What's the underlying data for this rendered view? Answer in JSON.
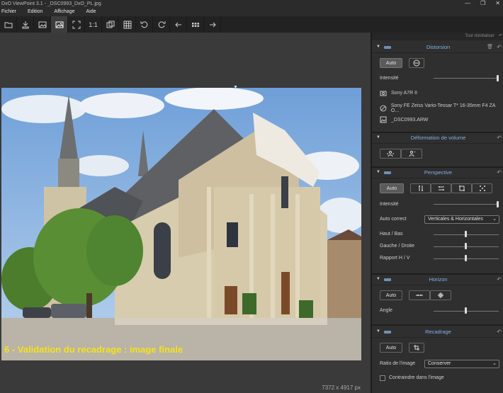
{
  "window": {
    "title": "DxO ViewPoint 3.1 - _DSC0993_DxO_PL.jpg",
    "minimize": "—",
    "maximize": "❐",
    "close": "✕"
  },
  "menu": {
    "items": [
      "Fichier",
      "Edition",
      "Affichage",
      "Aide"
    ]
  },
  "toolbar": {
    "one_to_one": "1:1"
  },
  "viewer": {
    "caption": "6 - Validation du recadrage : image finale",
    "dimensions": "7372 x 4917 px"
  },
  "panel": {
    "reset_all": "Tout réinitialiser",
    "distorsion": {
      "title": "Distorsion",
      "auto": "Auto",
      "intensity_label": "Intensité",
      "intensity": 1.0,
      "camera": "Sony A7R II",
      "lens": "Sony FE Zeiss Vario-Tessar T* 16-35mm F4 ZA O...",
      "file": "_DSC0993.ARW"
    },
    "volume": {
      "title": "Déformation de volume"
    },
    "perspective": {
      "title": "Perspective",
      "auto": "Auto",
      "intensity_label": "Intensité",
      "intensity": 1.0,
      "auto_correct_label": "Auto correct",
      "auto_correct_value": "Verticales & Horizontales",
      "haut_bas_label": "Haut / Bas",
      "haut_bas": 0.5,
      "gauche_droite_label": "Gauche / Droite",
      "gauche_droite": 0.5,
      "rapport_label": "Rapport H / V",
      "rapport": 0.5
    },
    "horizon": {
      "title": "Horizon",
      "auto": "Auto",
      "angle_label": "Angle",
      "angle": 0.5
    },
    "recadrage": {
      "title": "Recadrage",
      "auto": "Auto",
      "ratio_label": "Ratio de l'image",
      "ratio_value": "Conserver",
      "constrain_label": "Contraindre dans l'image"
    }
  },
  "colors": {
    "accent_title": "#7fb0e8",
    "caption": "#f5e21a",
    "sky": "#8fb7e6"
  }
}
